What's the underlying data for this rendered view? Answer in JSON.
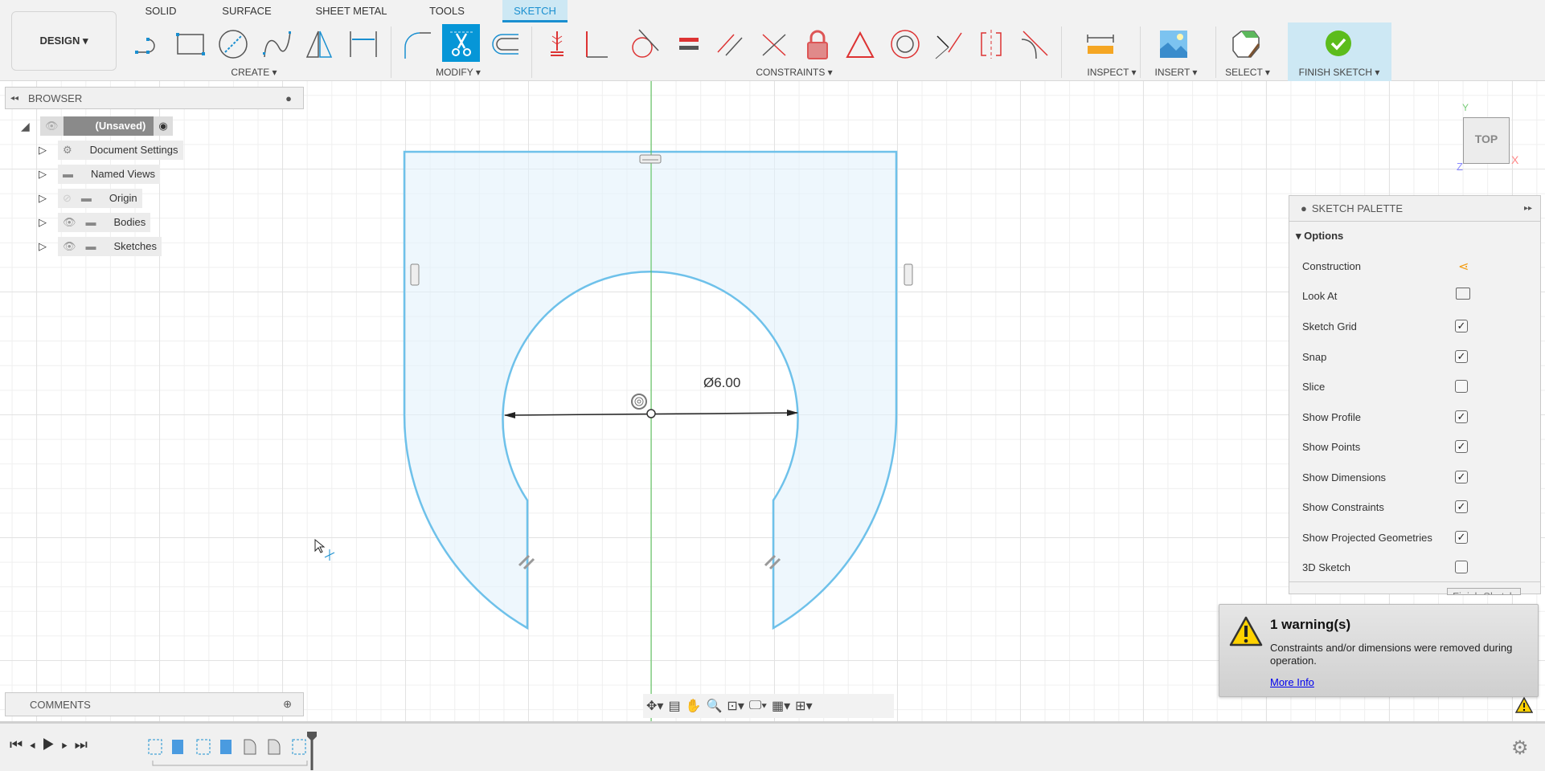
{
  "toolbar": {
    "workspace": "DESIGN ▾",
    "tabs": [
      "SOLID",
      "SURFACE",
      "SHEET METAL",
      "TOOLS",
      "SKETCH"
    ],
    "active_tab": "SKETCH",
    "groups": {
      "create": "CREATE ▾",
      "modify": "MODIFY ▾",
      "constraints": "CONSTRAINTS ▾",
      "inspect": "INSPECT ▾",
      "insert": "INSERT ▾",
      "select": "SELECT ▾",
      "finish": "FINISH SKETCH ▾"
    },
    "active_tool": "trim",
    "accent": "#0696d7"
  },
  "browser": {
    "title": "BROWSER",
    "root": "(Unsaved)",
    "items": [
      {
        "label": "Document Settings",
        "icon": "gear-icon"
      },
      {
        "label": "Named Views",
        "icon": "folder-icon"
      },
      {
        "label": "Origin",
        "icon": "folder-icon",
        "visible": false
      },
      {
        "label": "Bodies",
        "icon": "folder-icon",
        "visible": true
      },
      {
        "label": "Sketches",
        "icon": "folder-icon",
        "visible": true
      }
    ]
  },
  "comments": {
    "title": "COMMENTS"
  },
  "sketch": {
    "dimension": "Ø6.00",
    "profile_color": "#6ec1ea",
    "axis_color": "#4cc04c"
  },
  "viewcube": {
    "face": "TOP",
    "x": "X",
    "y": "Y",
    "z": "Z"
  },
  "palette": {
    "title": "SKETCH PALETTE",
    "section": "Options",
    "rows": [
      {
        "label": "Construction",
        "type": "icon"
      },
      {
        "label": "Look At",
        "type": "icon"
      },
      {
        "label": "Sketch Grid",
        "checked": true
      },
      {
        "label": "Snap",
        "checked": true
      },
      {
        "label": "Slice",
        "checked": false
      },
      {
        "label": "Show Profile",
        "checked": true
      },
      {
        "label": "Show Points",
        "checked": true
      },
      {
        "label": "Show Dimensions",
        "checked": true
      },
      {
        "label": "Show Constraints",
        "checked": true
      },
      {
        "label": "Show Projected Geometries",
        "checked": true
      },
      {
        "label": "3D Sketch",
        "checked": false
      }
    ],
    "finish_button": "Finish Sketch"
  },
  "warning": {
    "title": "1 warning(s)",
    "message": "Constraints and/or dimensions were removed during operation.",
    "link": "More Info"
  }
}
